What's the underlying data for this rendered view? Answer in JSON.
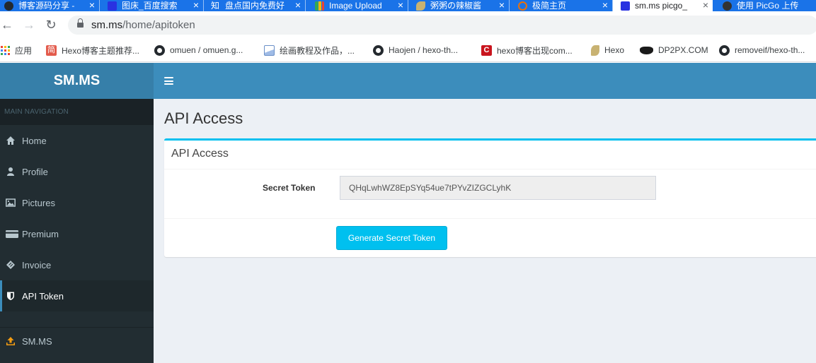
{
  "tabs": [
    {
      "title": "博客源码分享 -",
      "icon": "github-icon",
      "color": "#24292e"
    },
    {
      "title": "图床_百度搜索",
      "icon": "baidu-icon",
      "color": "#2932e1"
    },
    {
      "title": "盘点国内免费好",
      "icon": "zhihu-icon",
      "color": "#0084ff",
      "prefix": "知"
    },
    {
      "title": "Image Upload",
      "icon": "chart-icon",
      "color": "#34a853"
    },
    {
      "title": "粥粥の辣椒酱",
      "icon": "feather-icon",
      "color": "#c8b272"
    },
    {
      "title": "极简主页",
      "icon": "search-icon",
      "color": "#e8710a"
    },
    {
      "title": "sm.ms picgo_",
      "icon": "baidu-icon",
      "color": "#2932e1"
    },
    {
      "title": "使用 PicGo 上传",
      "icon": "spider-icon",
      "color": "#333333"
    }
  ],
  "browser": {
    "url_host": "sm.ms",
    "url_path": "/home/apitoken"
  },
  "bookmarks": [
    {
      "label": "应用",
      "icon": "apps-icon"
    },
    {
      "label": "Hexo博客主题推荐...",
      "icon": "jian-icon",
      "badge": "简"
    },
    {
      "label": "omuen / omuen.g...",
      "icon": "github-icon"
    },
    {
      "label": "绘画教程及作品，...",
      "icon": "image-icon"
    },
    {
      "label": "Haojen / hexo-th...",
      "icon": "github-icon"
    },
    {
      "label": "hexo博客出现com...",
      "icon": "c-icon",
      "badge": "C"
    },
    {
      "label": "Hexo",
      "icon": "feather-icon"
    },
    {
      "label": "DP2PX.COM",
      "icon": "batman-icon"
    },
    {
      "label": "removeif/hexo-th...",
      "icon": "github-icon"
    }
  ],
  "app": {
    "logo": "SM.MS",
    "nav_header": "MAIN NAVIGATION",
    "nav": [
      {
        "label": "Home",
        "icon": "home-icon"
      },
      {
        "label": "Profile",
        "icon": "user-icon"
      },
      {
        "label": "Pictures",
        "icon": "picture-icon"
      },
      {
        "label": "Premium",
        "icon": "credit-card-icon"
      },
      {
        "label": "Invoice",
        "icon": "ticket-icon"
      },
      {
        "label": "API Token",
        "icon": "shield-icon",
        "active": true
      },
      {
        "label": "SM.MS",
        "icon": "upload-icon"
      }
    ]
  },
  "main": {
    "page_title": "API Access",
    "box_title": "API Access",
    "secret_label": "Secret Token",
    "secret_value": "QHqLwhWZ8EpSYq54ue7tPYvZIZGCLyhK",
    "generate_button": "Generate Secret Token"
  },
  "colors": {
    "tab_bar": "#1a73e8",
    "header": "#3c8dbc",
    "logo_bg": "#367fa9",
    "sidebar": "#222d32",
    "accent": "#00c0ef",
    "upload_icon": "#f39c12"
  }
}
